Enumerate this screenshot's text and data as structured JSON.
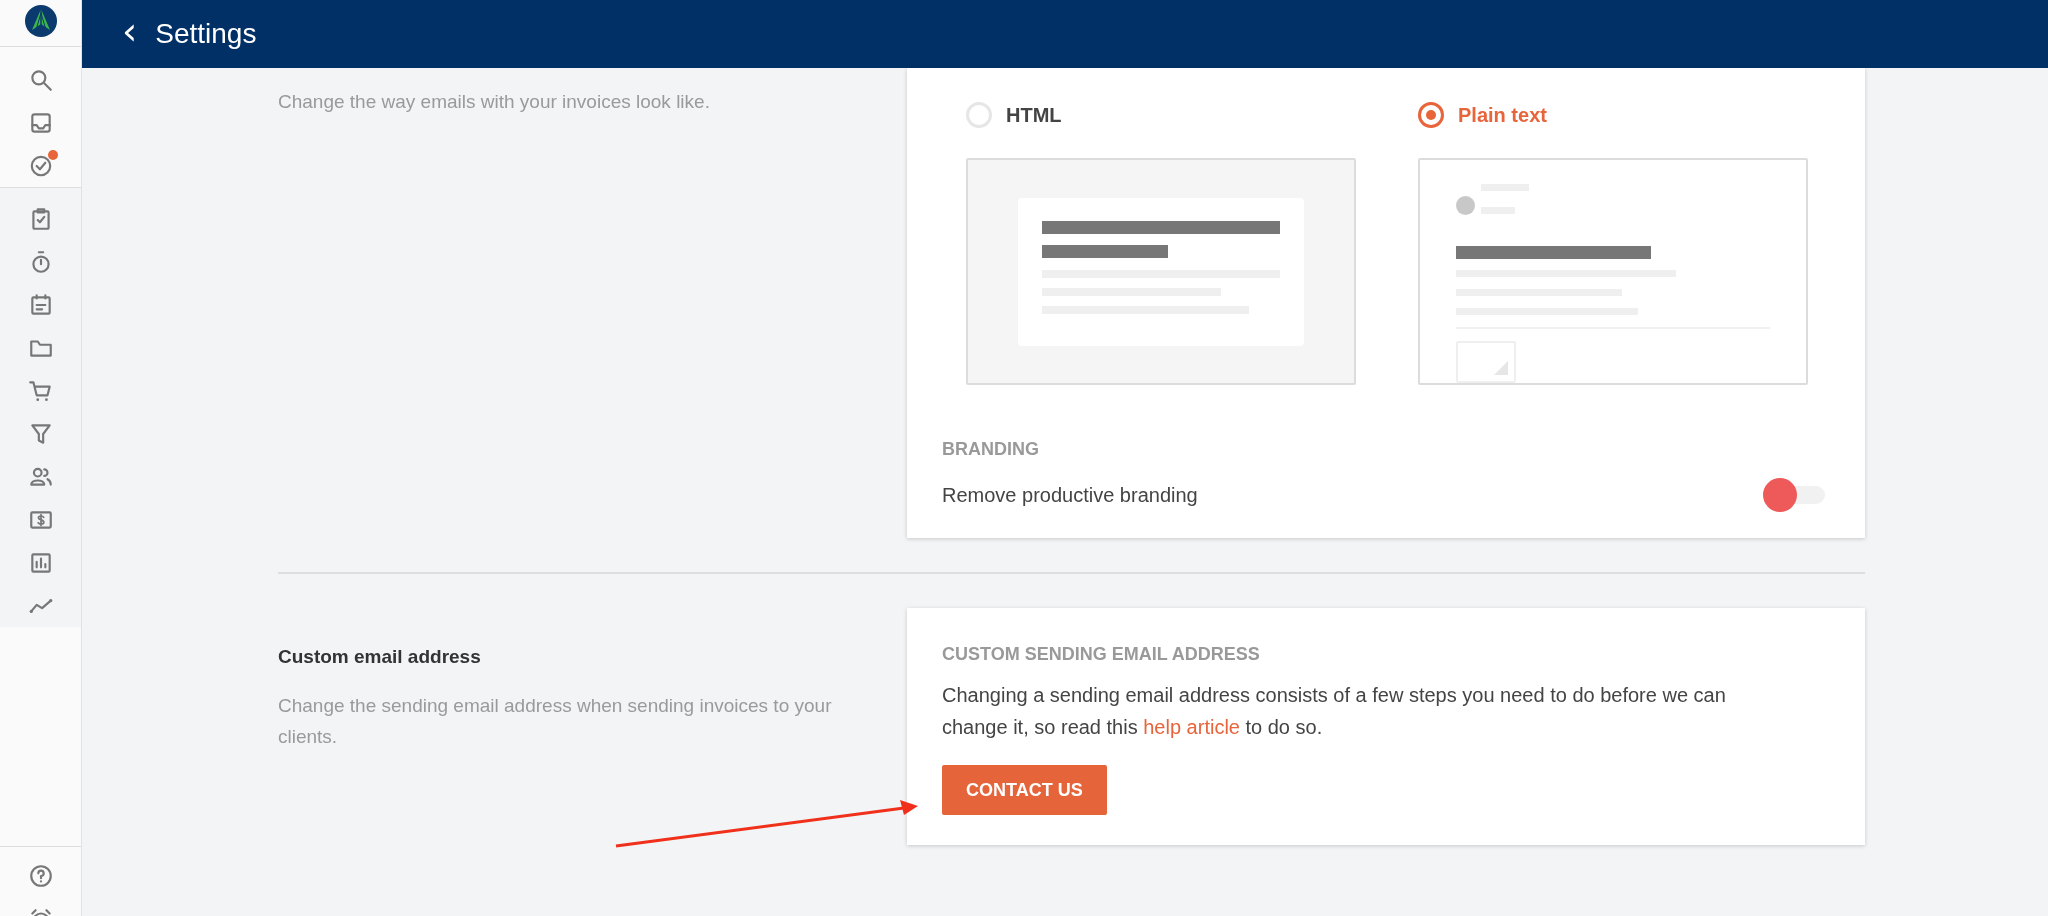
{
  "sidebar": {
    "top_items": [
      {
        "badge": false
      },
      {
        "badge": false
      },
      {
        "badge": true
      }
    ],
    "main_items": [
      {
        "badge": false
      },
      {
        "badge": false
      },
      {
        "badge": false
      },
      {
        "badge": false
      },
      {
        "badge": false
      },
      {
        "badge": false
      },
      {
        "badge": false
      },
      {
        "badge": false
      },
      {
        "badge": false
      },
      {
        "badge": false
      }
    ],
    "bottom_items": [
      {
        "badge": false
      },
      {
        "badge": false
      }
    ]
  },
  "header": {
    "back": "‹",
    "title": "Settings"
  },
  "sections": [
    {
      "kind": "format",
      "description": "Change the way emails with your invoices look like.",
      "options": [
        {
          "label": "HTML",
          "kind": "html",
          "selected": false
        },
        {
          "label": "Plain text",
          "kind": "plain",
          "selected": true
        }
      ],
      "branding": {
        "heading": "BRANDING",
        "label": "Remove productive branding",
        "on": false
      }
    },
    {
      "kind": "custom",
      "title": "Custom email address",
      "description": "Change the sending email address when sending invoices to your clients.",
      "card_heading": "CUSTOM SENDING EMAIL ADDRESS",
      "text_before": "Changing a sending email address consists of a few steps you need to do before we can change it, so read this",
      "link": "help article",
      "text_after": "to do so.",
      "button": "CONTACT US"
    }
  ]
}
